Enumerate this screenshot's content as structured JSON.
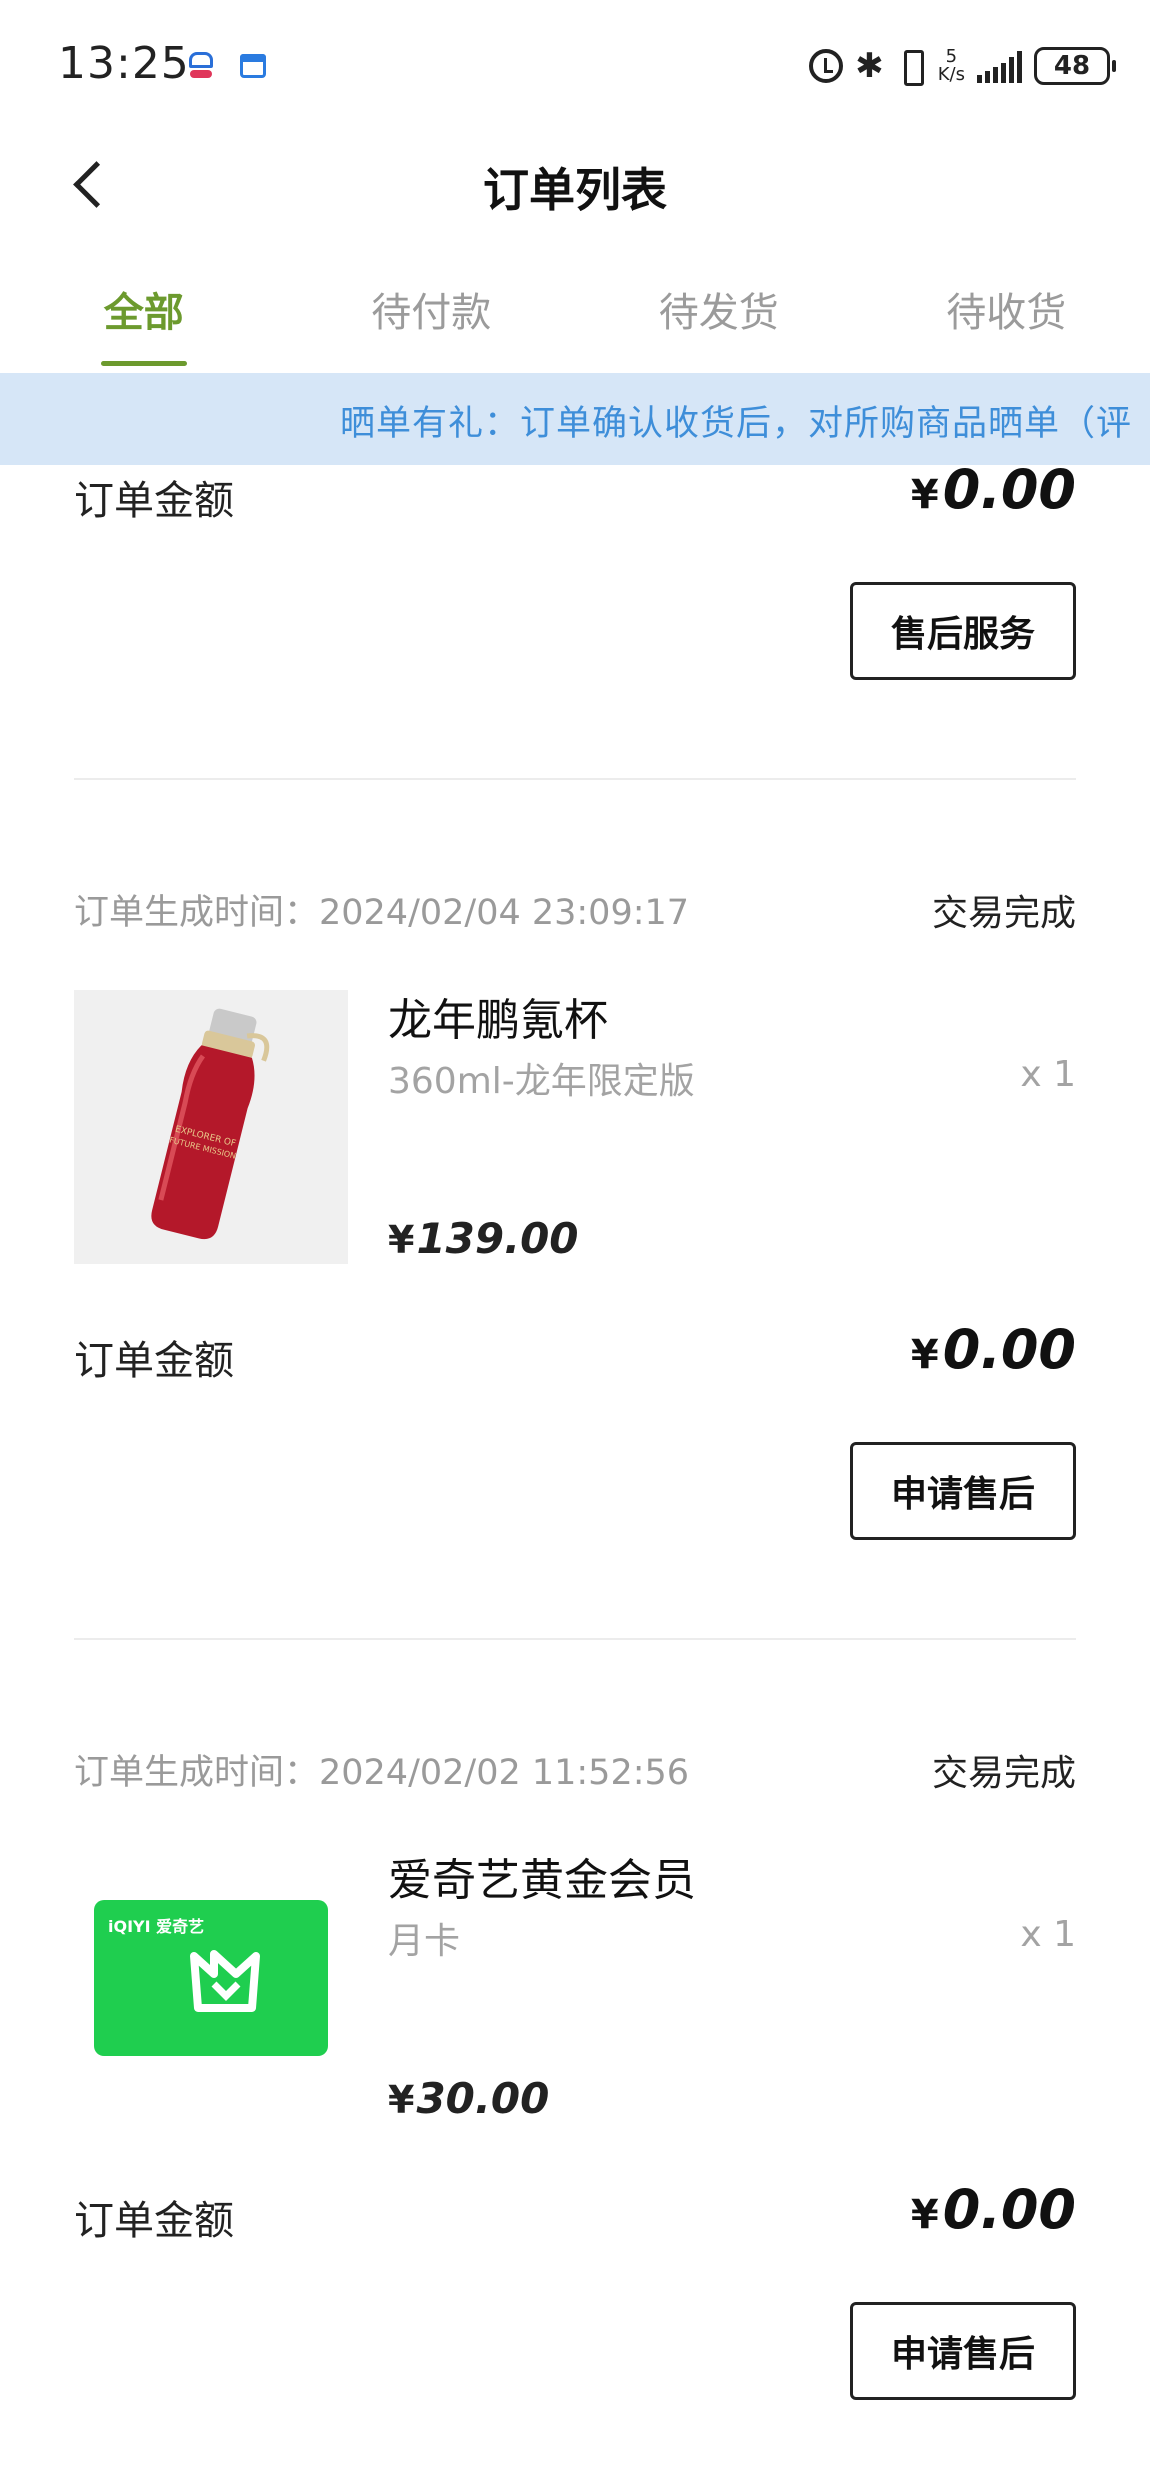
{
  "status_bar": {
    "time": "13:25",
    "net_speed_value": "5",
    "net_speed_unit": "K/s",
    "battery": "48"
  },
  "header": {
    "title": "订单列表"
  },
  "tabs": [
    {
      "label": "全部",
      "active": true
    },
    {
      "label": "待付款",
      "active": false
    },
    {
      "label": "待发货",
      "active": false
    },
    {
      "label": "待收货",
      "active": false
    }
  ],
  "notice": {
    "text": "晒单有礼：订单确认收货后，对所购商品晒单（评"
  },
  "orders": [
    {
      "amount_label": "订单金额",
      "amount_value": "0.00",
      "currency": "¥",
      "action": "售后服务"
    },
    {
      "time_label": "订单生成时间：2024/02/04 23:09:17",
      "status": "交易完成",
      "product": {
        "name": "龙年鹏氪杯",
        "spec": "360ml-龙年限定版",
        "qty": "x 1",
        "price": "139.00",
        "image_text_line1": "EXPLORER OF",
        "image_text_line2": "FUTURE MISSION"
      },
      "currency": "¥",
      "amount_label": "订单金额",
      "amount_value": "0.00",
      "action": "申请售后"
    },
    {
      "time_label": "订单生成时间：2024/02/02 11:52:56",
      "status": "交易完成",
      "product": {
        "name": "爱奇艺黄金会员",
        "spec": "月卡",
        "qty": "x 1",
        "price": "30.00",
        "image_logo": "iQIYI 爱奇艺"
      },
      "currency": "¥",
      "amount_label": "订单金额",
      "amount_value": "0.00",
      "action": "申请售后"
    }
  ],
  "colors": {
    "accent_green": "#6c9a2e",
    "notice_bg": "#d6e6f7",
    "notice_text": "#3e8ed9",
    "cup_red": "#b4182a",
    "iqiyi_green": "#1ed760"
  }
}
